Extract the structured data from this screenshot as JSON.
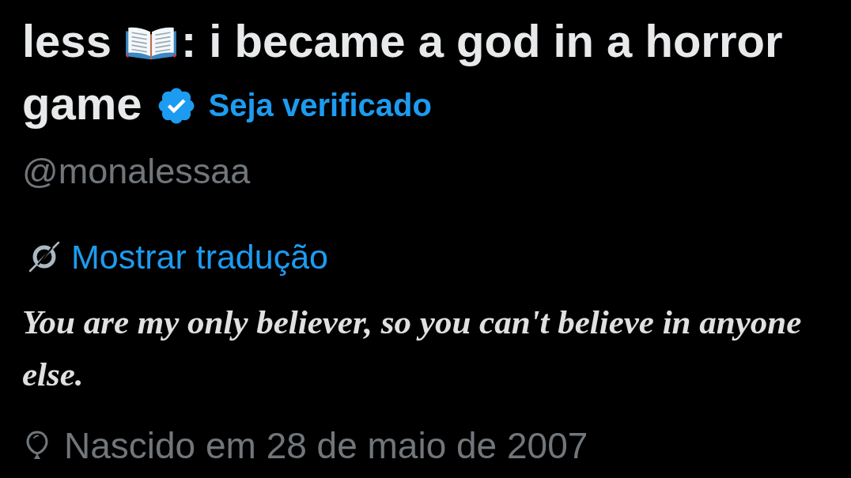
{
  "profile": {
    "name_parts": [
      {
        "kind": "text",
        "text": "less"
      },
      {
        "kind": "emoji"
      },
      {
        "kind": "text",
        "text": ": i became a god in a horror"
      },
      {
        "kind": "text",
        "text": "game"
      }
    ],
    "verified": true,
    "verify_link": "Seja verificado",
    "handle": "@monalessaa"
  },
  "translate_link": "Mostrar tradução",
  "bio": "You are my only believer, so you can't believe in anyone else.",
  "birthday": "Nascido em 28 de maio de 2007"
}
